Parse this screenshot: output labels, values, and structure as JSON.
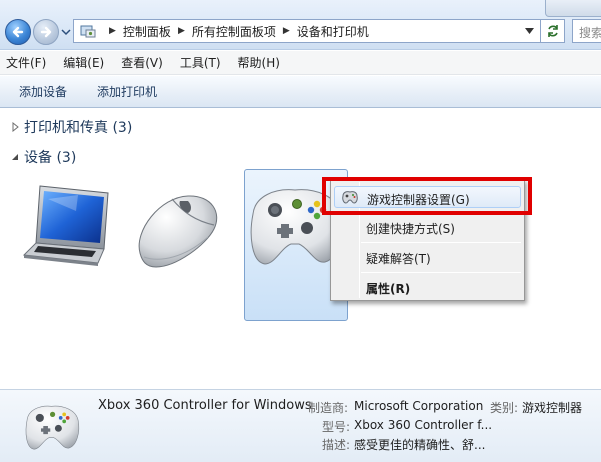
{
  "breadcrumb": {
    "items": [
      "控制面板",
      "所有控制面板项",
      "设备和打印机"
    ]
  },
  "search": {
    "placeholder": "搜索"
  },
  "menu": {
    "items": [
      "文件(F)",
      "编辑(E)",
      "查看(V)",
      "工具(T)",
      "帮助(H)"
    ]
  },
  "toolbar": {
    "buttons": [
      "添加设备",
      "添加打印机"
    ]
  },
  "groups": {
    "printers": {
      "title": "打印机和传真 (3)",
      "expanded": false
    },
    "devices": {
      "title": "设备 (3)",
      "expanded": true
    }
  },
  "devices": [
    {
      "icon": "laptop-icon"
    },
    {
      "icon": "mouse-icon"
    },
    {
      "icon": "xbox-controller-icon",
      "selected": true
    }
  ],
  "context_menu": {
    "items": [
      {
        "label": "游戏控制器设置(G)",
        "icon": "gamepad-icon",
        "highlighted": true
      },
      {
        "label": "创建快捷方式(S)"
      },
      {
        "label": "疑难解答(T)"
      },
      {
        "label": "属性(R)",
        "bold": true
      }
    ],
    "highlight_color": "#e00000"
  },
  "details": {
    "name": "Xbox 360 Controller for Windows",
    "manufacturer_label": "制造商:",
    "manufacturer": "Microsoft Corporation",
    "category_label": "类别:",
    "category": "游戏控制器",
    "model_label": "型号:",
    "model": "Xbox 360 Controller f...",
    "description_label": "描述:",
    "description": "感受更佳的精确性、舒..."
  }
}
